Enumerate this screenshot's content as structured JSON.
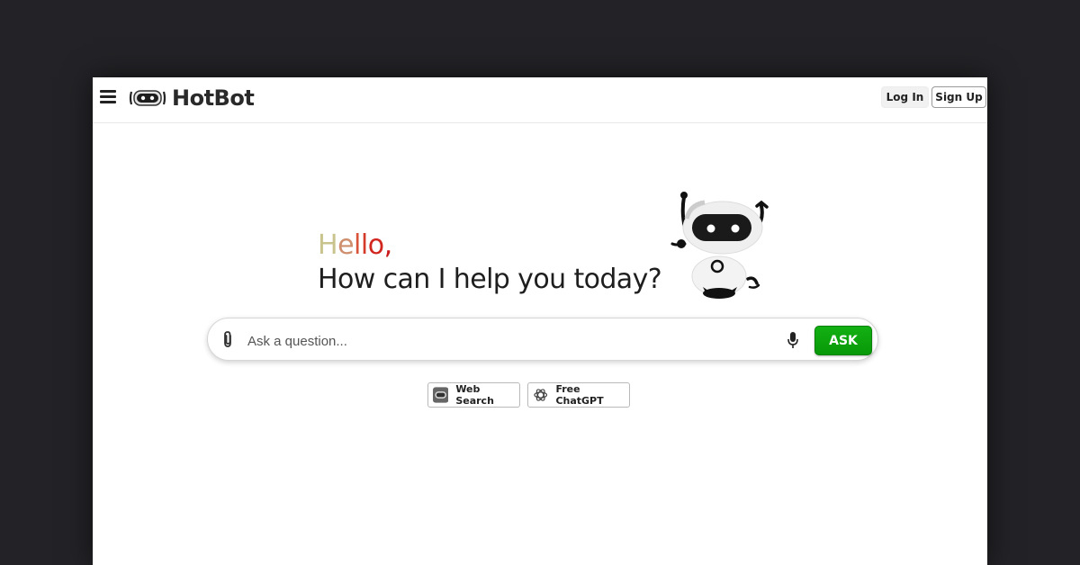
{
  "navbar": {
    "menu_icon": "hamburger-menu-icon",
    "brand_name": "HotBot",
    "login_label": "Log In",
    "signup_label": "Sign Up"
  },
  "hero": {
    "greeting": [
      "H",
      "e",
      "l",
      "l",
      "o",
      ","
    ],
    "greeting_colors": [
      "#c9c48e",
      "#cf8f6e",
      "#d8553a",
      "#d33a2a",
      "#d0261e",
      "#c81a1a"
    ],
    "question": "How can I help you today?",
    "robot_icon": "robot-mascot"
  },
  "search": {
    "attach_icon": "paperclip-icon",
    "placeholder": "Ask a question...",
    "value": "",
    "mic_icon": "microphone-icon",
    "ask_label": "ASK",
    "ask_color": "#0ba30b"
  },
  "modes": [
    {
      "label": "Web Search",
      "icon": "eye-robot-icon"
    },
    {
      "label": "Free ChatGPT",
      "icon": "openai-icon"
    }
  ]
}
